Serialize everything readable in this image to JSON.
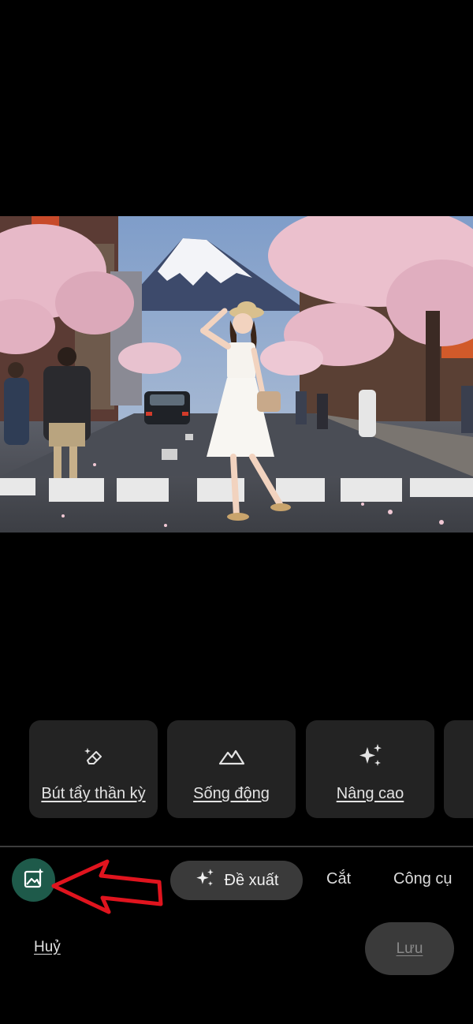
{
  "tools": [
    {
      "label": "Bút tẩy thần kỳ",
      "icon": "magic-eraser-icon"
    },
    {
      "label": "Sống động",
      "icon": "mountain-icon"
    },
    {
      "label": "Nâng cao",
      "icon": "sparkle-icon"
    }
  ],
  "tabs": {
    "suggest": "Đề xuất",
    "crop": "Cắt",
    "tools": "Công cụ"
  },
  "auto_icon": "auto-enhance-icon",
  "annotation": "red-arrow-pointing-at-auto-enhance-button",
  "actions": {
    "cancel": "Huỷ",
    "save": "Lưu"
  },
  "colors": {
    "background": "#000000",
    "card": "#232323",
    "auto_button": "#1e5a4a",
    "annotation_arrow": "#e0141e"
  }
}
